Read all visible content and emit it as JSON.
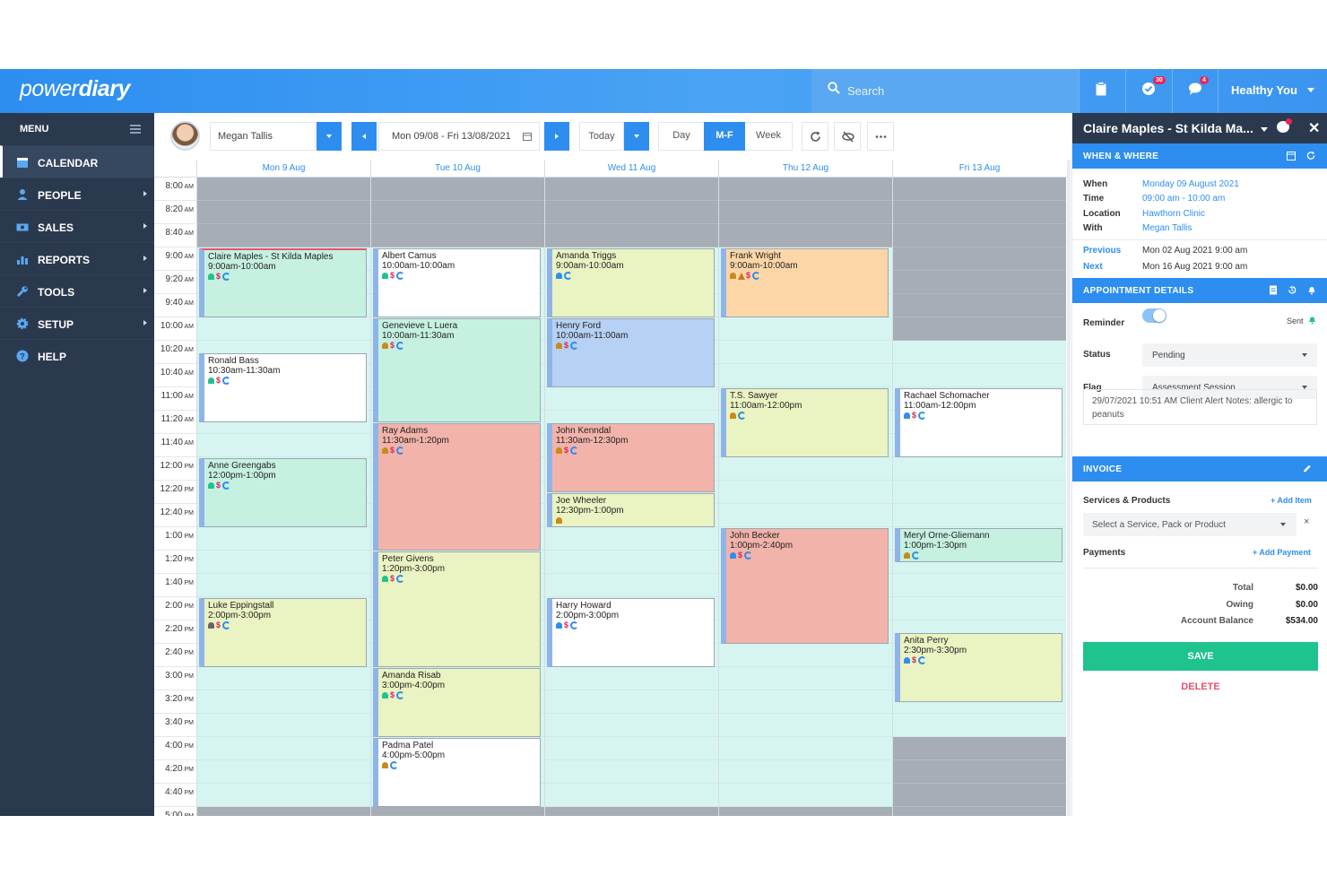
{
  "app": {
    "logo_regular": "power",
    "logo_bold": "diary"
  },
  "topbar": {
    "search_placeholder": "Search",
    "tasks_badge": "30",
    "messages_badge": "4",
    "user_name": "Healthy You"
  },
  "sidebar": {
    "menu_label": "MENU",
    "items": [
      {
        "label": "CALENDAR",
        "icon": "calendar-icon",
        "active": true,
        "has_arrow": false
      },
      {
        "label": "PEOPLE",
        "icon": "person-icon",
        "active": false,
        "has_arrow": true
      },
      {
        "label": "SALES",
        "icon": "cash-icon",
        "active": false,
        "has_arrow": true
      },
      {
        "label": "REPORTS",
        "icon": "chart-icon",
        "active": false,
        "has_arrow": true
      },
      {
        "label": "TOOLS",
        "icon": "wrench-icon",
        "active": false,
        "has_arrow": true
      },
      {
        "label": "SETUP",
        "icon": "gear-icon",
        "active": false,
        "has_arrow": true
      },
      {
        "label": "HELP",
        "icon": "help-icon",
        "active": false,
        "has_arrow": false
      }
    ]
  },
  "toolbar": {
    "staff": "Megan Tallis",
    "date_range": "Mon 09/08 - Fri 13/08/2021",
    "today": "Today",
    "view_day": "Day",
    "view_mf": "M-F",
    "view_week": "Week"
  },
  "calendar": {
    "days": [
      "Mon 9 Aug",
      "Tue 10 Aug",
      "Wed 11 Aug",
      "Thu 12 Aug",
      "Fri 13 Aug"
    ],
    "times": [
      [
        "8:00",
        "AM"
      ],
      [
        "8:20",
        "AM"
      ],
      [
        "8:40",
        "AM"
      ],
      [
        "9:00",
        "AM"
      ],
      [
        "9:20",
        "AM"
      ],
      [
        "9:40",
        "AM"
      ],
      [
        "10:00",
        "AM"
      ],
      [
        "10:20",
        "AM"
      ],
      [
        "10:40",
        "AM"
      ],
      [
        "11:00",
        "AM"
      ],
      [
        "11:20",
        "AM"
      ],
      [
        "11:40",
        "AM"
      ],
      [
        "12:00",
        "PM"
      ],
      [
        "12:20",
        "PM"
      ],
      [
        "12:40",
        "PM"
      ],
      [
        "1:00",
        "PM"
      ],
      [
        "1:20",
        "PM"
      ],
      [
        "1:40",
        "PM"
      ],
      [
        "2:00",
        "PM"
      ],
      [
        "2:20",
        "PM"
      ],
      [
        "2:40",
        "PM"
      ],
      [
        "3:00",
        "PM"
      ],
      [
        "3:20",
        "PM"
      ],
      [
        "3:40",
        "PM"
      ],
      [
        "4:00",
        "PM"
      ],
      [
        "4:20",
        "PM"
      ],
      [
        "4:40",
        "PM"
      ],
      [
        "5:00",
        "PM"
      ]
    ],
    "open_hours": [
      {
        "day": 0,
        "from": 3,
        "to": 27
      },
      {
        "day": 1,
        "from": 3,
        "to": 27
      },
      {
        "day": 2,
        "from": 3,
        "to": 27
      },
      {
        "day": 3,
        "from": 3,
        "to": 27
      },
      {
        "day": 4,
        "from": 7,
        "to": 24
      }
    ],
    "appointments": [
      {
        "day": 0,
        "start": 3,
        "slots": 3,
        "name": "Claire Maples - St Kilda Maples",
        "time": "9:00am-10:00am",
        "color": "#c6f1e1",
        "icons": [
          "bell-green",
          "dollar",
          "sync"
        ],
        "selected": true
      },
      {
        "day": 0,
        "start": 7.5,
        "slots": 3,
        "name": "Ronald Bass",
        "time": "10:30am-11:30am",
        "color": "#ffffff",
        "icons": [
          "bell-green",
          "dollar",
          "sync"
        ]
      },
      {
        "day": 0,
        "start": 12,
        "slots": 3,
        "name": "Anne Greengabs",
        "time": "12:00pm-1:00pm",
        "color": "#c6f1e1",
        "icons": [
          "bell-green",
          "dollar",
          "sync"
        ]
      },
      {
        "day": 0,
        "start": 18,
        "slots": 3,
        "name": "Luke Eppingstall",
        "time": "2:00pm-3:00pm",
        "color": "#eaf3c2",
        "icons": [
          "bell-grey",
          "dollar",
          "sync"
        ]
      },
      {
        "day": 1,
        "start": 3,
        "slots": 3,
        "name": "Albert Camus",
        "time": "10:00am-10:00am",
        "color": "#ffffff",
        "icons": [
          "bell-green",
          "dollar",
          "sync"
        ]
      },
      {
        "day": 1,
        "start": 6,
        "slots": 4.5,
        "name": "Genevieve L Luera",
        "time": "10:00am-11:30am",
        "color": "#c6f1e1",
        "icons": [
          "bell-gold",
          "dollar",
          "sync"
        ]
      },
      {
        "day": 1,
        "start": 10.5,
        "slots": 5.5,
        "name": "Ray Adams",
        "time": "11:30am-1:20pm",
        "color": "#f2b3aa",
        "icons": [
          "bell-gold",
          "dollar",
          "sync"
        ]
      },
      {
        "day": 1,
        "start": 16,
        "slots": 5,
        "name": "Peter Givens",
        "time": "1:20pm-3:00pm",
        "color": "#eaf3c2",
        "icons": [
          "bell-green",
          "dollar",
          "sync"
        ]
      },
      {
        "day": 1,
        "start": 21,
        "slots": 3,
        "name": "Amanda Risab",
        "time": "3:00pm-4:00pm",
        "color": "#eaf3c2",
        "icons": [
          "bell-green",
          "dollar",
          "sync"
        ]
      },
      {
        "day": 1,
        "start": 24,
        "slots": 3,
        "name": "Padma Patel",
        "time": "4:00pm-5:00pm",
        "color": "#ffffff",
        "icons": [
          "bell-gold",
          "sync"
        ]
      },
      {
        "day": 2,
        "start": 3,
        "slots": 3,
        "name": "Amanda Triggs",
        "time": "9:00am-10:00am",
        "color": "#eaf3c2",
        "icons": [
          "bell-blue",
          "sync"
        ]
      },
      {
        "day": 2,
        "start": 6,
        "slots": 3,
        "name": "Henry Ford",
        "time": "10:00am-11:00am",
        "color": "#b6d1f3",
        "icons": [
          "bell-gold",
          "dollar",
          "sync"
        ]
      },
      {
        "day": 2,
        "start": 10.5,
        "slots": 3,
        "name": "John Kenndal",
        "time": "11:30am-12:30pm",
        "color": "#f2b3aa",
        "icons": [
          "bell-gold",
          "dollar",
          "sync"
        ]
      },
      {
        "day": 2,
        "start": 13.5,
        "slots": 1.5,
        "name": "Joe Wheeler",
        "time": "12:30pm-1:00pm",
        "color": "#eaf3c2",
        "icons": [
          "bell-gold"
        ]
      },
      {
        "day": 2,
        "start": 18,
        "slots": 3,
        "name": "Harry Howard",
        "time": "2:00pm-3:00pm",
        "color": "#ffffff",
        "icons": [
          "bell-blue",
          "dollar",
          "sync"
        ]
      },
      {
        "day": 3,
        "start": 3,
        "slots": 3,
        "name": "Frank Wright",
        "time": "9:00am-10:00am",
        "color": "#fdd6a8",
        "icons": [
          "bell-gold",
          "warn",
          "dollar",
          "sync"
        ]
      },
      {
        "day": 3,
        "start": 9,
        "slots": 3,
        "name": "T.S. Sawyer",
        "time": "11:00am-12:00pm",
        "color": "#eaf3c2",
        "icons": [
          "bell-gold",
          "sync"
        ]
      },
      {
        "day": 3,
        "start": 15,
        "slots": 5,
        "name": "John Becker",
        "time": "1:00pm-2:40pm",
        "color": "#f2b3aa",
        "icons": [
          "bell-blue",
          "dollar",
          "sync"
        ]
      },
      {
        "day": 4,
        "start": 9,
        "slots": 3,
        "name": "Rachael Schomacher",
        "time": "11:00am-12:00pm",
        "color": "#ffffff",
        "icons": [
          "bell-blue",
          "dollar",
          "sync"
        ]
      },
      {
        "day": 4,
        "start": 15,
        "slots": 1.5,
        "name": "Meryl Orne-Gliemann",
        "time": "1:00pm-1:30pm",
        "color": "#c6f1e1",
        "icons": [
          "bell-gold",
          "sync"
        ]
      },
      {
        "day": 4,
        "start": 19.5,
        "slots": 3,
        "name": "Anita Perry",
        "time": "2:30pm-3:30pm",
        "color": "#eaf3c2",
        "icons": [
          "bell-blue",
          "dollar",
          "sync"
        ]
      }
    ]
  },
  "panel": {
    "title": "Claire Maples - St Kilda Ma...",
    "when_where_label": "WHEN & WHERE",
    "when_label": "When",
    "when_value": "Monday 09 August 2021",
    "time_label": "Time",
    "time_value": "09:00 am - 10:00 am",
    "location_label": "Location",
    "location_value": "Hawthorn Clinic",
    "with_label": "With",
    "with_value": "Megan Tallis",
    "previous_label": "Previous",
    "previous_value": "Mon 02 Aug 2021 9:00 am",
    "next_label": "Next",
    "next_value": "Mon 16 Aug 2021 9:00 am",
    "appt_details_label": "APPOINTMENT DETAILS",
    "reminder_label": "Reminder",
    "reminder_on": true,
    "reminder_status": "Sent",
    "status_label": "Status",
    "status_value": "Pending",
    "flag_label": "Flag",
    "flag_value": "Assessment Session",
    "notes": "29/07/2021 10:51 AM Client Alert Notes: allergic to peanuts",
    "invoice_label": "INVOICE",
    "services_label": "Services & Products",
    "add_item": "+ Add Item",
    "service_placeholder": "Select a Service, Pack or Product",
    "clear_symbol": "×",
    "payments_label": "Payments",
    "add_payment": "+ Add Payment",
    "total_label": "Total",
    "total_value": "$0.00",
    "owing_label": "Owing",
    "owing_value": "$0.00",
    "balance_label": "Account Balance",
    "balance_value": "$534.00",
    "save": "SAVE",
    "delete": "DELETE"
  },
  "colors": {
    "brand_blue": "#2d8ef0",
    "sidebar_bg": "#2b394e",
    "open_slot": "#d6f5f1",
    "closed_slot": "#a6adb4",
    "save_green": "#1ec38f",
    "delete_red": "#e9506a"
  }
}
